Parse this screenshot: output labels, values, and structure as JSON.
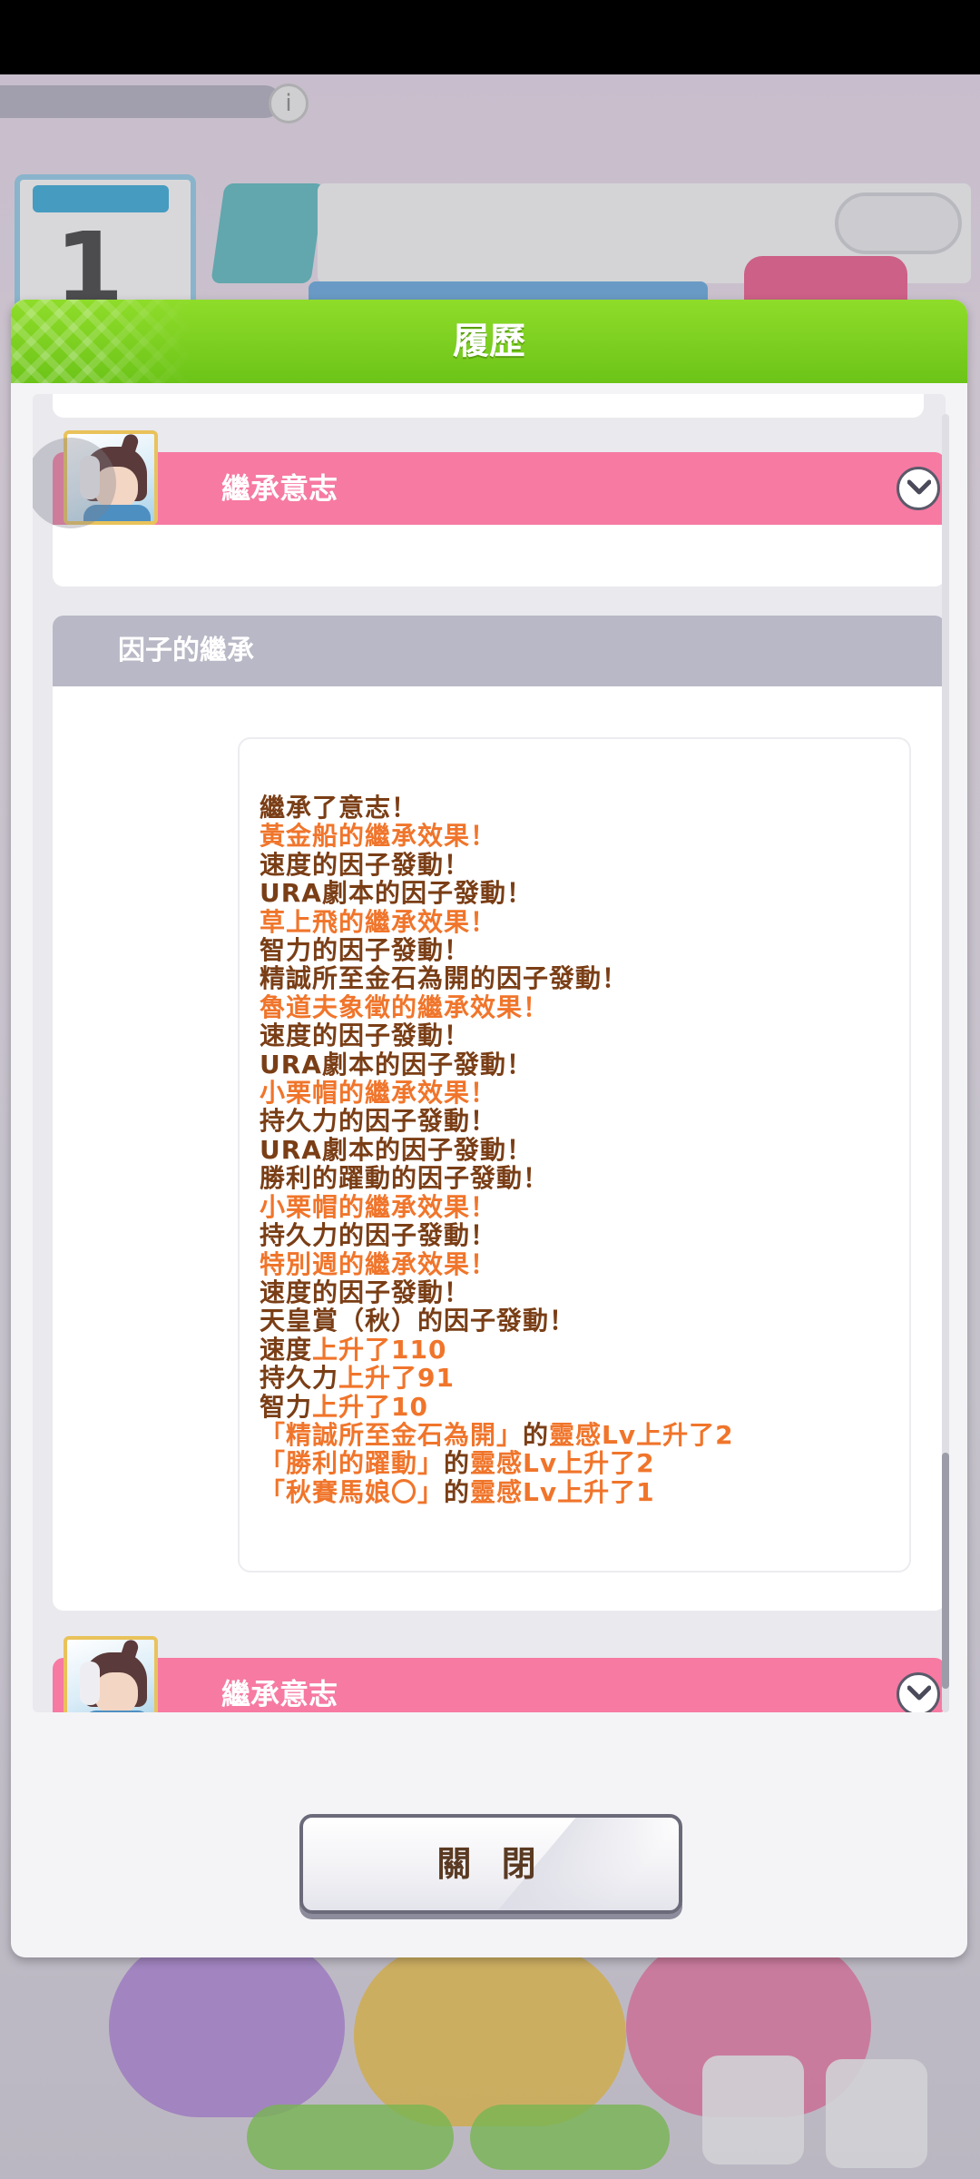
{
  "dialog": {
    "title": "履歷",
    "close_label": "關 閉"
  },
  "entries": {
    "inherit_will_label_1": "繼承意志",
    "factor_section_label": "因子的繼承",
    "inherit_will_label_2": "繼承意志"
  },
  "log_lines": [
    {
      "text": "繼承了意志！",
      "color": "brown"
    },
    {
      "text": "黃金船的繼承效果！",
      "color": "orange"
    },
    {
      "text": "速度的因子發動！",
      "color": "brown"
    },
    {
      "text": "URA劇本的因子發動！",
      "color": "brown"
    },
    {
      "text": "草上飛的繼承效果！",
      "color": "orange"
    },
    {
      "text": "智力的因子發動！",
      "color": "brown"
    },
    {
      "text": "精誠所至金石為開的因子發動！",
      "color": "brown"
    },
    {
      "text": "魯道夫象徵的繼承效果！",
      "color": "orange"
    },
    {
      "text": "速度的因子發動！",
      "color": "brown"
    },
    {
      "text": "URA劇本的因子發動！",
      "color": "brown"
    },
    {
      "text": "小栗帽的繼承效果！",
      "color": "orange"
    },
    {
      "text": "持久力的因子發動！",
      "color": "brown"
    },
    {
      "text": "URA劇本的因子發動！",
      "color": "brown"
    },
    {
      "text": "勝利的躍動的因子發動！",
      "color": "brown"
    },
    {
      "text": "小栗帽的繼承效果！",
      "color": "orange"
    },
    {
      "text": "持久力的因子發動！",
      "color": "brown"
    },
    {
      "text": "特別週的繼承效果！",
      "color": "orange"
    },
    {
      "text": "速度的因子發動！",
      "color": "brown"
    },
    {
      "text": "天皇賞（秋）的因子發動！",
      "color": "brown"
    }
  ],
  "stat_lines": [
    {
      "stat": "速度",
      "change": "上升了110"
    },
    {
      "stat": "持久力",
      "change": "上升了91"
    },
    {
      "stat": "智力",
      "change": "上升了10"
    }
  ],
  "hint_lines": [
    {
      "skill": "「精誠所至金石為開」",
      "mid": "的",
      "change": "靈感Lv上升了2"
    },
    {
      "skill": "「勝利的躍動」",
      "mid": "的",
      "change": "靈感Lv上升了2"
    },
    {
      "skill": "「秋賽馬娘〇」",
      "mid": "的",
      "change": "靈感Lv上升了1"
    }
  ],
  "colors": {
    "header_green": "#7ccf20",
    "will_pink": "#f67aa2",
    "section_gray": "#b8b8c6",
    "text_brown": "#7a3e16",
    "text_orange": "#f0752b"
  }
}
